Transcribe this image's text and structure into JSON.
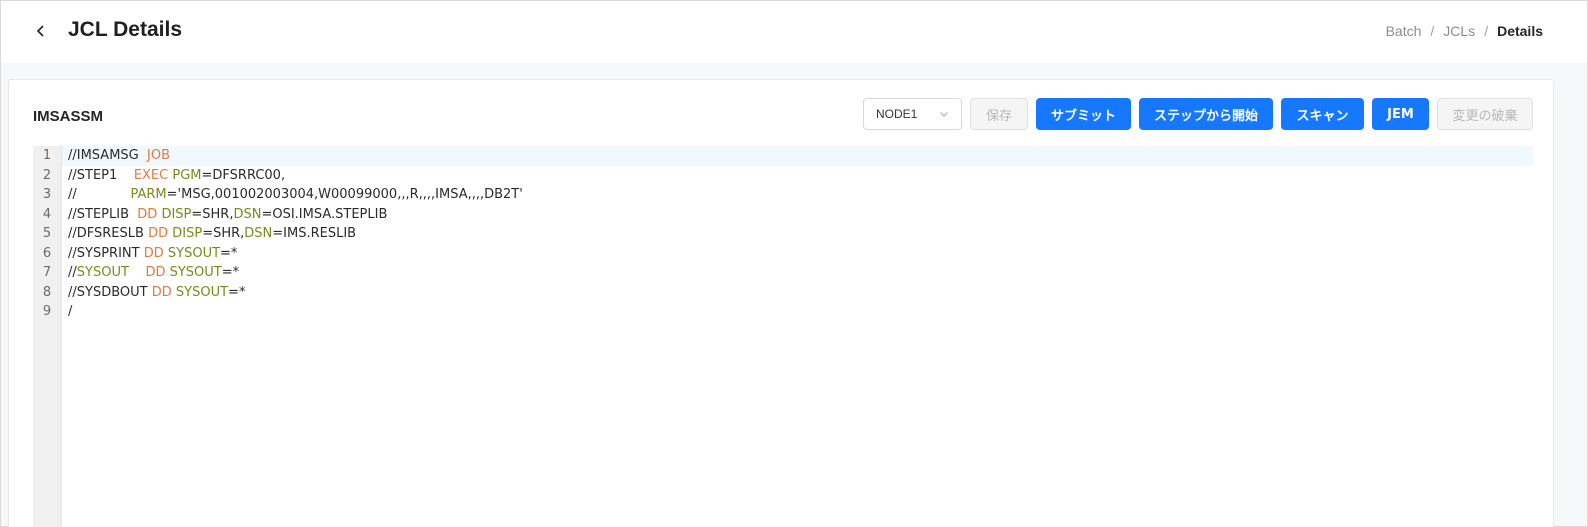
{
  "header": {
    "back_icon": "chevron-left-icon",
    "title": "JCL Details",
    "breadcrumb": [
      "Batch",
      "JCLs",
      "Details"
    ],
    "separator": "/"
  },
  "card": {
    "job_name": "IMSASSM",
    "node_select": {
      "value": "NODE1",
      "icon": "chevron-down-icon"
    },
    "buttons": {
      "save": "保存",
      "submit": "サブミット",
      "start_from_step": "ステップから開始",
      "scan": "スキャン",
      "jem": "JEM",
      "discard": "変更の破棄"
    }
  },
  "editor": {
    "lines": [
      [
        [
          "plain",
          "//IMSAMSG  "
        ],
        [
          "kw",
          "JOB"
        ]
      ],
      [
        [
          "plain",
          "//STEP1    "
        ],
        [
          "kw",
          "EXEC"
        ],
        [
          "plain",
          " "
        ],
        [
          "param",
          "PGM"
        ],
        [
          "plain",
          "=DFSRRC00,"
        ]
      ],
      [
        [
          "plain",
          "//             "
        ],
        [
          "param",
          "PARM"
        ],
        [
          "plain",
          "='MSG,001002003004,W00099000,,,R,,,,IMSA,,,,DB2T'"
        ]
      ],
      [
        [
          "plain",
          "//STEPLIB  "
        ],
        [
          "kw",
          "DD"
        ],
        [
          "plain",
          " "
        ],
        [
          "param",
          "DISP"
        ],
        [
          "plain",
          "=SHR,"
        ],
        [
          "param",
          "DSN"
        ],
        [
          "plain",
          "=OSI.IMSA.STEPLIB"
        ]
      ],
      [
        [
          "plain",
          "//DFSRESLB "
        ],
        [
          "kw",
          "DD"
        ],
        [
          "plain",
          " "
        ],
        [
          "param",
          "DISP"
        ],
        [
          "plain",
          "=SHR,"
        ],
        [
          "param",
          "DSN"
        ],
        [
          "plain",
          "=IMS.RESLIB"
        ]
      ],
      [
        [
          "plain",
          "//SYSPRINT "
        ],
        [
          "kw",
          "DD"
        ],
        [
          "plain",
          " "
        ],
        [
          "param",
          "SYSOUT"
        ],
        [
          "plain",
          "=*"
        ]
      ],
      [
        [
          "plain",
          "//"
        ],
        [
          "param",
          "SYSOUT"
        ],
        [
          "plain",
          "    "
        ],
        [
          "kw",
          "DD"
        ],
        [
          "plain",
          " "
        ],
        [
          "param",
          "SYSOUT"
        ],
        [
          "plain",
          "=*"
        ]
      ],
      [
        [
          "plain",
          "//SYSDBOUT "
        ],
        [
          "kw",
          "DD"
        ],
        [
          "plain",
          " "
        ],
        [
          "param",
          "SYSOUT"
        ],
        [
          "plain",
          "=*"
        ]
      ],
      [
        [
          "plain",
          "/"
        ]
      ]
    ],
    "line_numbers": [
      "1",
      "2",
      "3",
      "4",
      "5",
      "6",
      "7",
      "8",
      "9"
    ],
    "active_line": 1
  },
  "colors": {
    "primary": "#1677ff",
    "keyword": "#e07b3b",
    "param": "#7a8a1a",
    "active_line_bg": "#f1f8ff"
  }
}
